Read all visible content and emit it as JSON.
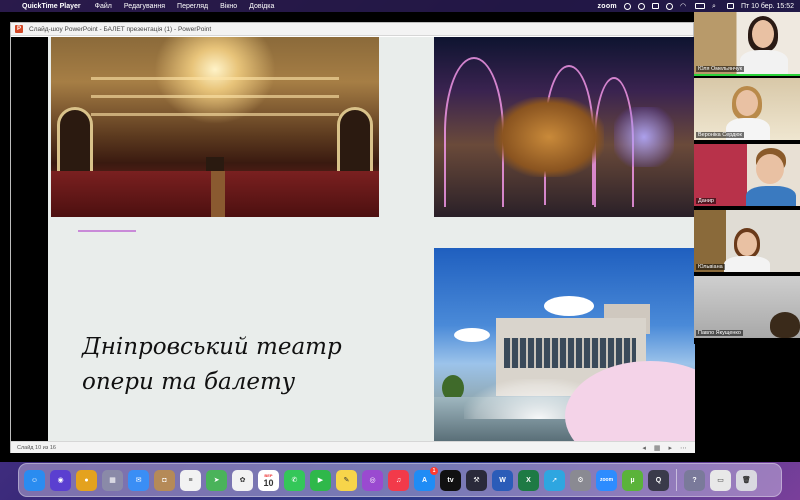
{
  "menubar": {
    "app_name": "QuickTime Player",
    "menus": [
      "Файл",
      "Редагування",
      "Перегляд",
      "Вікно",
      "Довідка"
    ],
    "zoom_label": "zoom",
    "clock": "Пт 10 бер.  15:52"
  },
  "powerpoint": {
    "title": "Слайд-шоу PowerPoint  -  БАЛЕТ презентація (1)  -  PowerPoint",
    "logo_letter": "P",
    "status_text": "Слайд 10 из 16",
    "slide": {
      "title_line1": "Дніпровський театр",
      "title_line2": "опери та балету"
    }
  },
  "zoom_participants": [
    {
      "name": "Юля Омельянчук"
    },
    {
      "name": "Вероніка Сердюк"
    },
    {
      "name": "Данир"
    },
    {
      "name": "Юльвіана"
    },
    {
      "name": "Павло Якущенко"
    }
  ],
  "dock": {
    "calendar_month": "ВЕР",
    "calendar_day": "10",
    "appstore_badge": "1",
    "apps": [
      {
        "icon": "finder-icon",
        "color": "#2a8cf0",
        "glyph": "☺"
      },
      {
        "icon": "siri-icon",
        "color": "#5a3fd0",
        "glyph": "◉"
      },
      {
        "icon": "chrome-icon",
        "color": "#e4a21e",
        "glyph": "●"
      },
      {
        "icon": "launchpad-icon",
        "color": "#8a8aa8",
        "glyph": "▦"
      },
      {
        "icon": "mail-icon",
        "color": "#3a8ef5",
        "glyph": "✉"
      },
      {
        "icon": "contacts-icon",
        "color": "#b58a58",
        "glyph": "◘"
      },
      {
        "icon": "reminders-icon",
        "color": "#f2f2f2",
        "glyph": "≡"
      },
      {
        "icon": "maps-icon",
        "color": "#4ab35a",
        "glyph": "➤"
      },
      {
        "icon": "photos-icon",
        "color": "#f2f2f2",
        "glyph": "✿"
      },
      {
        "icon": "calendar-icon",
        "color": "#ffffff",
        "glyph": ""
      },
      {
        "icon": "messages-icon",
        "color": "#34c759",
        "glyph": "✆"
      },
      {
        "icon": "facetime-icon",
        "color": "#2fb84a",
        "glyph": "▶"
      },
      {
        "icon": "notes-icon",
        "color": "#f7d54a",
        "glyph": "✎"
      },
      {
        "icon": "podcasts-icon",
        "color": "#9a4ad0",
        "glyph": "◎"
      },
      {
        "icon": "music-icon",
        "color": "#f23a4a",
        "glyph": "♫"
      },
      {
        "icon": "appstore-icon",
        "color": "#1f8cf5",
        "glyph": "A"
      },
      {
        "icon": "appletv-icon",
        "color": "#111111",
        "glyph": "tv"
      },
      {
        "icon": "xcode-icon",
        "color": "#2a2a3a",
        "glyph": "⚒"
      },
      {
        "icon": "word-icon",
        "color": "#2b5cb8",
        "glyph": "W"
      },
      {
        "icon": "excel-icon",
        "color": "#1e7a44",
        "glyph": "X"
      },
      {
        "icon": "telegram-icon",
        "color": "#2ea6e0",
        "glyph": "➚"
      },
      {
        "icon": "settings-icon",
        "color": "#8a8a92",
        "glyph": "⚙"
      },
      {
        "icon": "zoom-icon",
        "color": "#2d8cff",
        "glyph": "zoom"
      },
      {
        "icon": "utorrent-icon",
        "color": "#5ab33a",
        "glyph": "µ"
      },
      {
        "icon": "quicktime-icon",
        "color": "#3a3a4a",
        "glyph": "Q"
      },
      {
        "icon": "help-icon",
        "color": "#7a7a9a",
        "glyph": "?"
      },
      {
        "icon": "preview-icon",
        "color": "#e8e8e8",
        "glyph": "▭"
      },
      {
        "icon": "trash-icon",
        "color": "#d9d9e0",
        "glyph": "🗑"
      }
    ]
  },
  "colors": {
    "slide_bg": "#e9edeb",
    "accent": "#c98ad8",
    "active_speaker": "#2ad23a"
  }
}
